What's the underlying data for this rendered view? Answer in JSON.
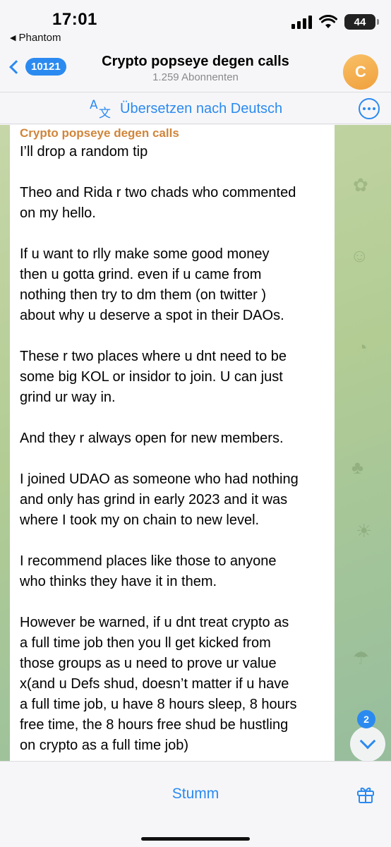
{
  "status_bar": {
    "time": "17:01",
    "back_app": "Phantom",
    "battery": "44"
  },
  "header": {
    "back_count": "10121",
    "title": "Crypto popseye degen calls",
    "subtitle": "1.259 Abonnenten",
    "avatar_letter": "C"
  },
  "translate_bar": {
    "label": "Übersetzen nach Deutsch"
  },
  "message": {
    "sender": "Crypto popseye degen calls",
    "lines": [
      "I’ll drop a random tip",
      "",
      "Theo and Rida r two chads who commented",
      "on my hello.",
      "",
      "If u want to rlly make some good money",
      "then u gotta grind. even if u came from",
      "nothing then try to dm them (on twitter )",
      "about why u deserve a spot in their DAOs.",
      "",
      "These r two places where u dnt need to be",
      "some big KOL or insidor to join. U can just",
      "grind ur way in.",
      "",
      "And they r always open for new members.",
      "",
      "I joined UDAO as someone who had nothing",
      "and only has grind in early 2023 and it was",
      "where I took my on chain to new level.",
      "",
      "I recommend places like those to anyone",
      "who thinks they have it in them.",
      "",
      "However be warned, if u dnt treat crypto as",
      "a full time job then you ll get kicked from",
      "those groups as u need to prove ur value",
      "x(and u Defs shud, doesn’t matter if u have",
      "a full time job, u have 8 hours sleep, 8 hours",
      "free time, the 8 hours free shud be hustling",
      "on crypto as a full time job)"
    ],
    "reaction": "❤"
  },
  "scroll": {
    "unread_count": "2"
  },
  "bottom_bar": {
    "mute_label": "Stumm"
  },
  "colors": {
    "accent": "#2b8af0",
    "sender": "#d0853a",
    "avatar": "#f0a03c"
  }
}
